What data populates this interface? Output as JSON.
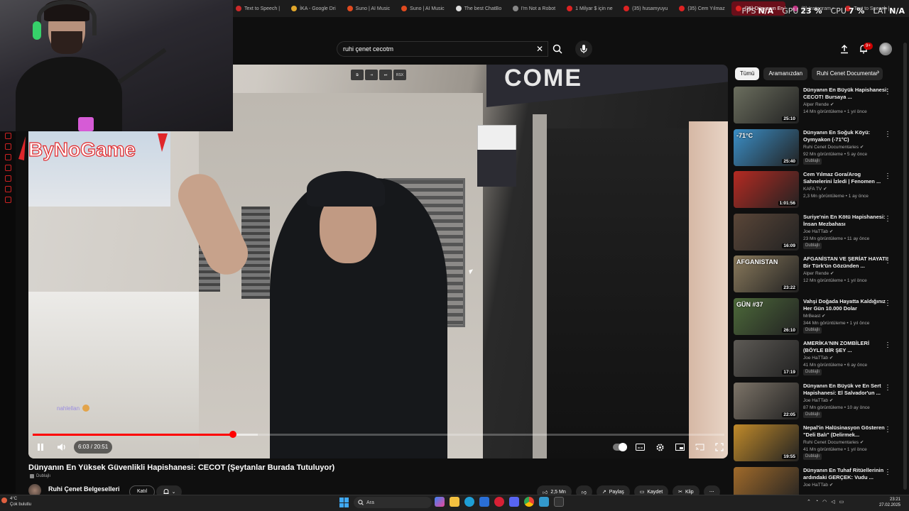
{
  "browser": {
    "tabs": [
      {
        "label": "Text to Speech |",
        "icon": "tts-icon",
        "color": "#cc2a2a"
      },
      {
        "label": "İKA - Google Dri",
        "icon": "drive-icon",
        "color": "#e2a72b"
      },
      {
        "label": "Suno | AI Music",
        "icon": "suno-icon",
        "color": "#e04a1f"
      },
      {
        "label": "Suno | AI Music",
        "icon": "suno-icon",
        "color": "#e04a1f"
      },
      {
        "label": "The best ChatBo",
        "icon": "chatbot-icon",
        "color": "#dddddd"
      },
      {
        "label": "I'm Not a Robot",
        "icon": "robot-icon",
        "color": "#888888"
      },
      {
        "label": "1 Milyar $ için ne",
        "icon": "youtube-icon",
        "color": "#dd2222"
      },
      {
        "label": "(35) husamyuyu",
        "icon": "youtube-icon",
        "color": "#dd2222"
      },
      {
        "label": "(35) Cem Yılmaz",
        "icon": "youtube-icon",
        "color": "#dd2222"
      },
      {
        "label": "(35) Dünyanın En Yük",
        "icon": "youtube-icon",
        "color": "#dd2222",
        "active": true
      },
      {
        "label": "(9) Instagram •",
        "icon": "instagram-icon",
        "color": "#c13584"
      },
      {
        "label": "Text to Speech |",
        "icon": "tts-icon",
        "color": "#cc2a2a"
      }
    ]
  },
  "perf": {
    "fps_label": "FPS",
    "fps_value": "N/A",
    "gpu_label": "GPU",
    "gpu_value": "23 %",
    "cpu_label": "CPU",
    "cpu_value": "7 %",
    "lat_label": "LAT",
    "lat_value": "N/A"
  },
  "header": {
    "search_value": "ruhi çenet cecotm",
    "clear_glyph": "✕",
    "notif_count": "9+"
  },
  "player": {
    "logo_text": "ByNoGame",
    "chat_message": "nahlellan",
    "pip_buttons": [
      "⧉",
      "⇥",
      "⏭",
      "RSX"
    ],
    "current_time": "6:03",
    "duration": "20:51",
    "time_display": "6:03 / 20:51",
    "progress_fraction": 0.29,
    "buffered_fraction": 0.325,
    "banner_text": "COME"
  },
  "video": {
    "title": "Dünyanın En Yüksek Güvenlikli Hapishanesi: CECOT (Şeytanlar Burada Tutuluyor)",
    "dub_label": "Dublajlı",
    "channel": "Ruhi Çenet Belgeselleri",
    "join_label": "Katıl",
    "likes": "2,5 Mn",
    "share_label": "Paylaş",
    "save_label": "Kaydet",
    "clip_label": "Klip",
    "more_glyph": "⋯"
  },
  "chips": {
    "items": [
      "Tümü",
      "Aramanızdan",
      "Ruhi Cenet Documentar"
    ],
    "active_index": 0
  },
  "recommendations": [
    {
      "title": "Dünyanın En Büyük Hapishanesi: CECOT! Bursaya ...",
      "channel": "Alper Rende",
      "verified": true,
      "meta": "14 Mn görüntüleme • 1 yıl önce",
      "duration": "25:10",
      "badge": "",
      "thumb_color": "#6b6e5e"
    },
    {
      "title": "Dünyanın En Soğuk Köyü: Oymyakon (-71°C)",
      "channel": "Ruhi Cenet Documentaries",
      "verified": true,
      "meta": "92 Mn görüntüleme • 5 ay önce",
      "duration": "25:40",
      "badge": "Dublajlı",
      "thumb_color": "#3b8fc7",
      "overlay": "-71°C"
    },
    {
      "title": "Cem Yılmaz Gora/Arog Sahnelerini İzledi | Fenomen ...",
      "channel": "KAFA TV",
      "verified": true,
      "meta": "2,3 Mn görüntüleme • 1 ay önce",
      "duration": "1:01:56",
      "badge": "",
      "thumb_color": "#b52a22"
    },
    {
      "title": "Suriye'nin En Kötü Hapishanesi: İnsan Mezbahası",
      "channel": "Joe HaTTab",
      "verified": true,
      "meta": "23 Mn görüntüleme • 11 ay önce",
      "duration": "16:09",
      "badge": "Dublajlı",
      "thumb_color": "#5a4638"
    },
    {
      "title": "AFGANİSTAN VE ŞERİAT HAYATI! Bir Türk'ün Gözünden ...",
      "channel": "Alper Rende",
      "verified": true,
      "meta": "12 Mn görüntüleme • 1 yıl önce",
      "duration": "23:22",
      "badge": "",
      "thumb_color": "#8a7a5c",
      "overlay": "AFGANISTAN"
    },
    {
      "title": "Vahşi Doğada Hayatta Kaldığınız Her Gün 10.000 Dolar",
      "channel": "MrBeast",
      "verified": true,
      "meta": "344 Mn görüntüleme • 1 yıl önce",
      "duration": "26:10",
      "badge": "Dublajlı",
      "thumb_color": "#4d6a3a",
      "overlay": "GÜN #37"
    },
    {
      "title": "AMERİKA'NIN ZOMBİLERİ (BÖYLE BİR ŞEY ...",
      "channel": "Joe HaTTab",
      "verified": true,
      "meta": "41 Mn görüntüleme • 6 ay önce",
      "duration": "17:19",
      "badge": "Dublajlı",
      "thumb_color": "#5d5a55"
    },
    {
      "title": "Dünyanın En Büyük ve En Sert Hapishanesi: El Salvador'un ...",
      "channel": "Joe HaTTab",
      "verified": true,
      "meta": "87 Mn görüntüleme • 10 ay önce",
      "duration": "22:05",
      "badge": "Dublajlı",
      "thumb_color": "#7d7468"
    },
    {
      "title": "Nepal'in Halüsinasyon Gösteren \"Deli Balı\" (Delirmek...",
      "channel": "Ruhi Cenet Documentaries",
      "verified": true,
      "meta": "41 Mn görüntüleme • 1 yıl önce",
      "duration": "19:55",
      "badge": "Dublajlı",
      "thumb_color": "#c08a2a"
    },
    {
      "title": "Dünyanın En Tuhaf Ritüellerinin ardındaki GERÇEK: Vudu ...",
      "channel": "Joe HaTTab",
      "verified": true,
      "meta": "",
      "duration": "",
      "badge": "",
      "thumb_color": "#a06a2a"
    }
  ],
  "taskbar": {
    "weather_temp": "4°C",
    "weather_desc": "Çok bulutlu",
    "search_placeholder": "Ara",
    "time": "23:21",
    "date": "27.02.2025"
  },
  "colors": {
    "accent": "#ff0000",
    "background": "#0f0f0f",
    "chip_active": "#f1f1f1"
  }
}
